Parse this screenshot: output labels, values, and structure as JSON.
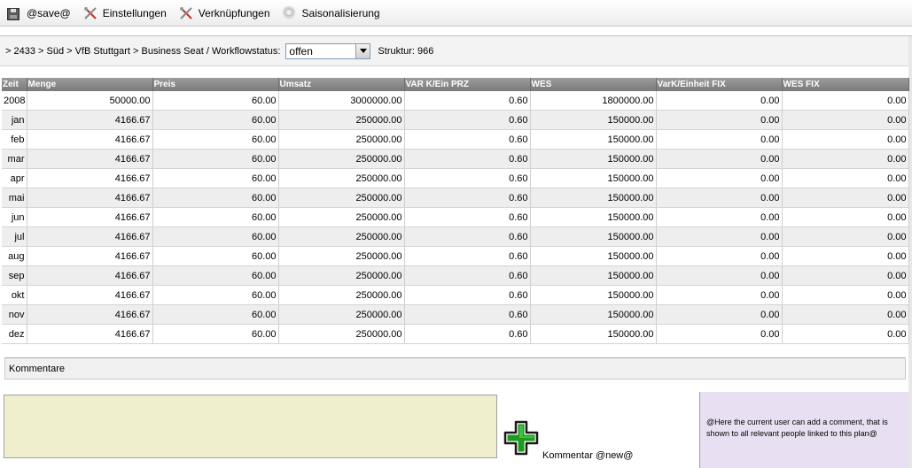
{
  "toolbar": {
    "save_label": "@save@",
    "settings_label": "Einstellungen",
    "links_label": "Verknüpfungen",
    "season_label": "Saisonalisierung"
  },
  "breadcrumb": {
    "path": "> 2433 > Süd > VfB Stuttgart > Business Seat / Workflowstatus:",
    "status_value": "offen",
    "struktur": "Struktur: 966"
  },
  "table": {
    "headers": [
      "Zeit",
      "Menge",
      "Preis",
      "Umsatz",
      "VAR K/Ein PRZ",
      "WES",
      "VarK/Einheit FIX",
      "WES FIX"
    ],
    "rows": [
      [
        "2008",
        "50000.00",
        "60.00",
        "3000000.00",
        "0.60",
        "1800000.00",
        "0.00",
        "0.00"
      ],
      [
        "jan",
        "4166.67",
        "60.00",
        "250000.00",
        "0.60",
        "150000.00",
        "0.00",
        "0.00"
      ],
      [
        "feb",
        "4166.67",
        "60.00",
        "250000.00",
        "0.60",
        "150000.00",
        "0.00",
        "0.00"
      ],
      [
        "mar",
        "4166.67",
        "60.00",
        "250000.00",
        "0.60",
        "150000.00",
        "0.00",
        "0.00"
      ],
      [
        "apr",
        "4166.67",
        "60.00",
        "250000.00",
        "0.60",
        "150000.00",
        "0.00",
        "0.00"
      ],
      [
        "mai",
        "4166.67",
        "60.00",
        "250000.00",
        "0.60",
        "150000.00",
        "0.00",
        "0.00"
      ],
      [
        "jun",
        "4166.67",
        "60.00",
        "250000.00",
        "0.60",
        "150000.00",
        "0.00",
        "0.00"
      ],
      [
        "jul",
        "4166.67",
        "60.00",
        "250000.00",
        "0.60",
        "150000.00",
        "0.00",
        "0.00"
      ],
      [
        "aug",
        "4166.67",
        "60.00",
        "250000.00",
        "0.60",
        "150000.00",
        "0.00",
        "0.00"
      ],
      [
        "sep",
        "4166.67",
        "60.00",
        "250000.00",
        "0.60",
        "150000.00",
        "0.00",
        "0.00"
      ],
      [
        "okt",
        "4166.67",
        "60.00",
        "250000.00",
        "0.60",
        "150000.00",
        "0.00",
        "0.00"
      ],
      [
        "nov",
        "4166.67",
        "60.00",
        "250000.00",
        "0.60",
        "150000.00",
        "0.00",
        "0.00"
      ],
      [
        "dez",
        "4166.67",
        "60.00",
        "250000.00",
        "0.60",
        "150000.00",
        "0.00",
        "0.00"
      ]
    ]
  },
  "comments": {
    "section_label": "Kommentare",
    "textarea_value": "",
    "new_label": "Kommentar @new@",
    "info_text": "@Here the current user can add a comment, that is shown to all relevant people linked to this plan@"
  },
  "icons": {
    "save": "floppy-disk-icon",
    "settings": "tools-icon",
    "links": "tools-icon",
    "season": "gear-icon",
    "add": "green-plus-icon"
  },
  "colors": {
    "header_bg": "#8a8a8a",
    "alt_row": "#eeeeee",
    "comment_bg": "#efefce",
    "info_bg": "#e8e0f2",
    "add_green": "#1e9a1e"
  }
}
